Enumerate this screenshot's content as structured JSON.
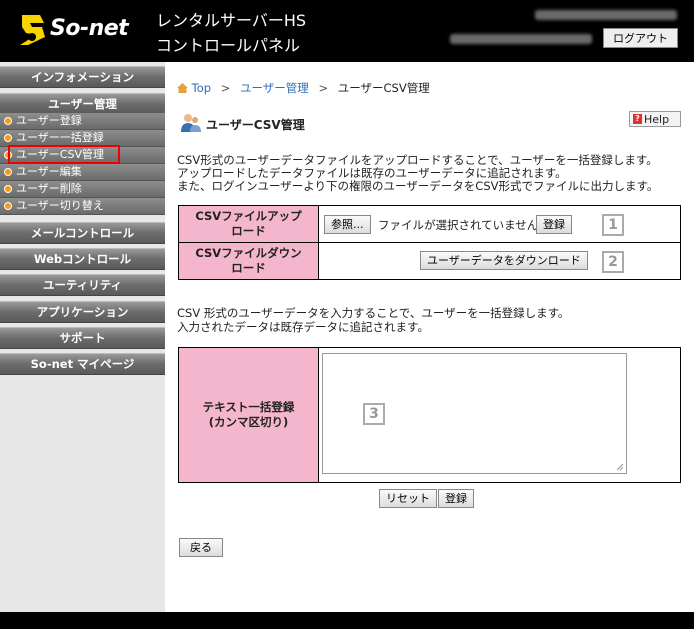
{
  "header": {
    "brand": "So-net",
    "title_line1": "レンタルサーバーHS",
    "title_line2": "コントロールパネル",
    "logout_label": "ログアウト"
  },
  "sidebar": {
    "info": "インフォメーション",
    "user_mgmt": "ユーザー管理",
    "items": [
      "ユーザー登録",
      "ユーザー一括登録",
      "ユーザーCSV管理",
      "ユーザー編集",
      "ユーザー削除",
      "ユーザー切り替え"
    ],
    "mail": "メールコントロール",
    "web": "Webコントロール",
    "utility": "ユーティリティ",
    "apps": "アプリケーション",
    "support": "サポート",
    "mypage": "So-net マイページ"
  },
  "breadcrumb": {
    "top": "Top",
    "user_mgmt": "ユーザー管理",
    "current": "ユーザーCSV管理"
  },
  "page": {
    "title": "ユーザーCSV管理",
    "help_label": "Help",
    "desc1": "CSV形式のユーザーデータファイルをアップロードすることで、ユーザーを一括登録します。",
    "desc2": "アップロードしたデータファイルは既存のユーザーデータに追記されます。",
    "desc3": "また、ログインユーザーより下の権限のユーザーデータをCSV形式でファイルに出力します。"
  },
  "upload": {
    "label_line1": "CSVファイルアップ",
    "label_line2": "ロード",
    "browse_label": "参照...",
    "no_file_text": "ファイルが選択されていません。",
    "register_label": "登録",
    "badge": "1"
  },
  "download": {
    "label_line1": "CSVファイルダウン",
    "label_line2": "ロード",
    "download_label": "ユーザーデータをダウンロード",
    "badge": "2"
  },
  "text_section": {
    "desc1": "CSV 形式のユーザーデータを入力することで、ユーザーを一括登録します。",
    "desc2": "入力されたデータは既存データに追記されます。",
    "label_line1": "テキスト一括登録",
    "label_line2": "(カンマ区切り)",
    "badge": "3",
    "reset_label": "リセット",
    "register_label": "登録"
  },
  "back_label": "戻る",
  "colors": {
    "header_bg": "#000000",
    "label_pink": "#f4b6cc",
    "link_blue": "#2a6fb8",
    "highlight_red": "#ee0000",
    "bullet_orange": "#f39a1a"
  }
}
